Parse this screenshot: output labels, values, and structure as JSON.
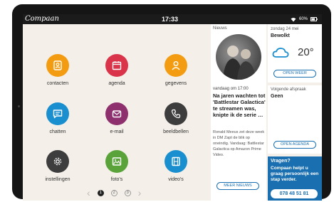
{
  "statusbar": {
    "logo": "Compaan",
    "time": "17:33",
    "battery_text": "60%"
  },
  "apps": [
    {
      "label": "contacten",
      "icon": "contacts-card-icon",
      "color": "#f39c12"
    },
    {
      "label": "agenda",
      "icon": "calendar-icon",
      "color": "#d9344a"
    },
    {
      "label": "gegevens",
      "icon": "person-icon",
      "color": "#f39c12"
    },
    {
      "label": "chatten",
      "icon": "chat-bubble-icon",
      "color": "#1a8fd0"
    },
    {
      "label": "e-mail",
      "icon": "envelope-icon",
      "color": "#8e2f6e"
    },
    {
      "label": "beeldbellen",
      "icon": "phone-icon",
      "color": "#3d3d3d"
    },
    {
      "label": "instellingen",
      "icon": "gear-icon",
      "color": "#3d3d3d"
    },
    {
      "label": "foto's",
      "icon": "picture-icon",
      "color": "#5aa33a"
    },
    {
      "label": "video's",
      "icon": "film-icon",
      "color": "#1a8fd0"
    }
  ],
  "pager": {
    "pages": [
      "1",
      "2",
      "3"
    ],
    "current": "1"
  },
  "news": {
    "header": "Nieuws",
    "time": "vandaag om 17:00",
    "title": "Na jaren wachten tot 'Battlestar Galactica' te streamen was, knipte ik de serie …",
    "body": "Ronald Meeus zet deze week in DM Zapt de blik op oneindig. Vandaag: Battlestar Galactica op Amazon Prime Video.",
    "more_button": "MEER NIEUWS"
  },
  "weather": {
    "date": "zondag 24 mei",
    "condition": "Bewolkt",
    "temperature": "20°",
    "button": "OPEN WEER"
  },
  "appointment": {
    "label": "Volgende afspraak",
    "value": "Geen",
    "button": "OPEN AGENDA"
  },
  "help": {
    "title": "Vragen?",
    "text": "Compaan helpt u graag persoonlijk een stap verder.",
    "phone": "078 48 51 81"
  }
}
